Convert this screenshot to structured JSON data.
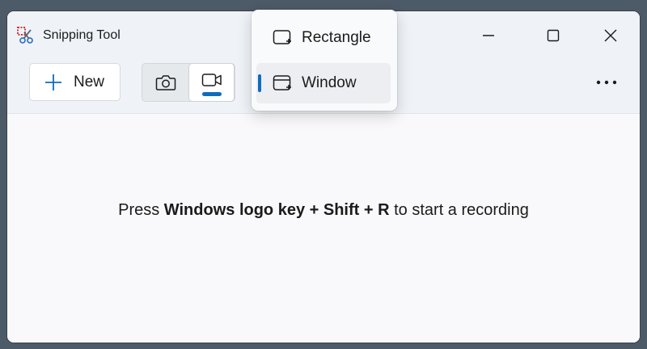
{
  "window": {
    "title": "Snipping Tool"
  },
  "toolbar": {
    "new_label": "New",
    "modes": [
      {
        "name": "camera-icon",
        "selected": false
      },
      {
        "name": "video-icon",
        "selected": true
      }
    ]
  },
  "dropdown": {
    "items": [
      {
        "label": "Rectangle",
        "icon": "rectangle-snip-icon",
        "selected": false
      },
      {
        "label": "Window",
        "icon": "window-snip-icon",
        "selected": true
      }
    ]
  },
  "content": {
    "hint_prefix": "Press ",
    "hint_keys_1": "Windows logo key",
    "hint_plus_1": " + ",
    "hint_keys_2": "Shift",
    "hint_plus_2": " + ",
    "hint_keys_3": "R",
    "hint_suffix": " to start a recording"
  },
  "colors": {
    "accent": "#0f6cbd",
    "desktop": "#4d5a67"
  }
}
